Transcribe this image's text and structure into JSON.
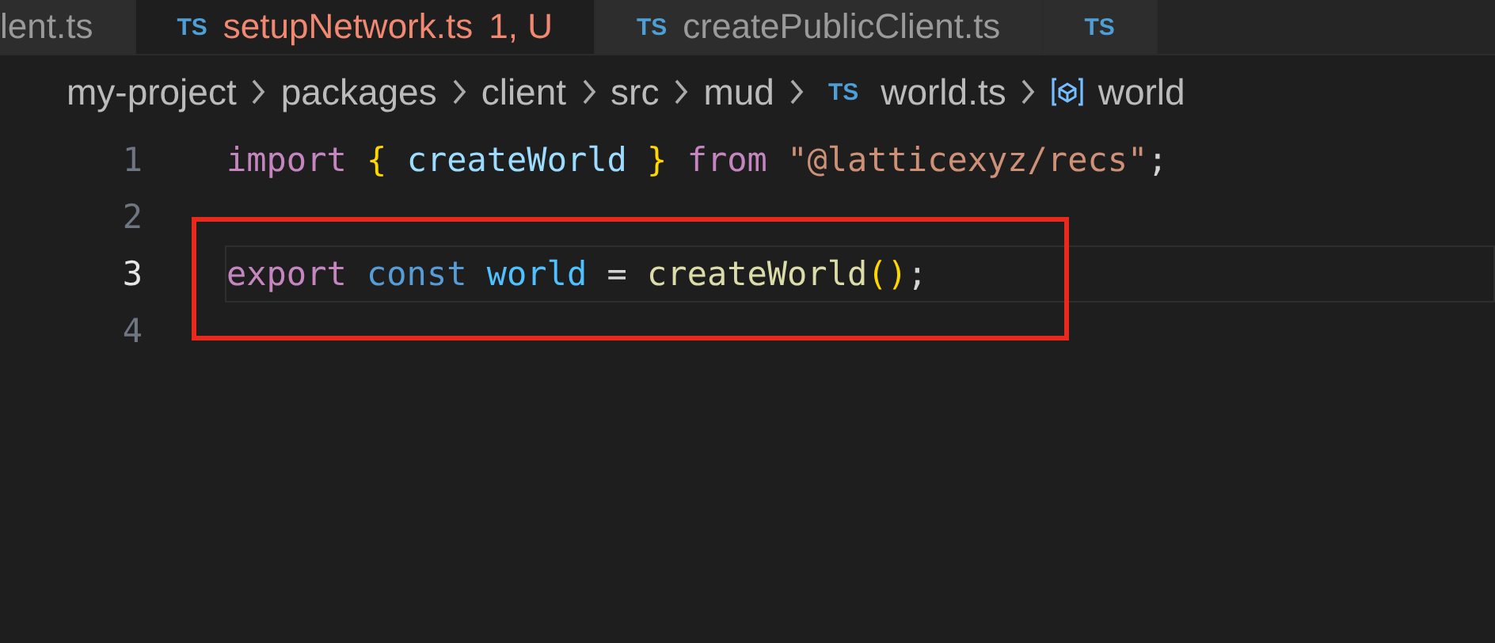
{
  "tabs": [
    {
      "label": "lent.ts",
      "selected": false
    },
    {
      "label": "setupNetwork.ts",
      "icon": "TS",
      "selected": true,
      "status": "1, U"
    },
    {
      "label": "createPublicClient.ts",
      "icon": "TS",
      "selected": false
    },
    {
      "icon": "TS",
      "selected": false
    }
  ],
  "breadcrumb": [
    {
      "label": "my-project",
      "kind": "folder"
    },
    {
      "label": "packages",
      "kind": "folder"
    },
    {
      "label": "client",
      "kind": "folder"
    },
    {
      "label": "src",
      "kind": "folder"
    },
    {
      "label": "mud",
      "kind": "folder"
    },
    {
      "label": "world.ts",
      "kind": "file",
      "icon": "TS"
    },
    {
      "label": "world",
      "kind": "symbol"
    }
  ],
  "editor": {
    "lines": [
      {
        "number": "1",
        "current": false,
        "tokens": [
          {
            "text": "import ",
            "kind": "keyword"
          },
          {
            "text": "{",
            "kind": "brace"
          },
          {
            "text": " createWorld ",
            "kind": "variable"
          },
          {
            "text": "}",
            "kind": "brace"
          },
          {
            "text": " from ",
            "kind": "keyword"
          },
          {
            "text": "\"@latticexyz/recs\"",
            "kind": "string"
          },
          {
            "text": ";",
            "kind": "plain"
          }
        ]
      },
      {
        "number": "2",
        "current": false
      },
      {
        "number": "3",
        "current": true,
        "tokens": [
          {
            "text": "export ",
            "kind": "keyword"
          },
          {
            "text": "const ",
            "kind": "storage"
          },
          {
            "text": "world",
            "kind": "constant"
          },
          {
            "text": " = ",
            "kind": "plain"
          },
          {
            "text": "createWorld",
            "kind": "function"
          },
          {
            "text": "()",
            "kind": "brace"
          },
          {
            "text": ";",
            "kind": "plain"
          }
        ]
      },
      {
        "number": "4",
        "current": false
      }
    ],
    "highlight_box": {
      "color": "#e8291c"
    }
  }
}
